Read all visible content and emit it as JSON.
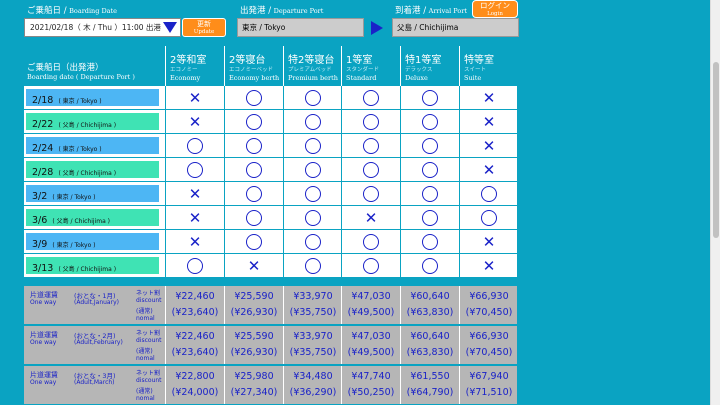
{
  "header": {
    "boarding_date_label_jp": "ご乗船日 /",
    "boarding_date_label_en": "Boarding Date",
    "boarding_date_value": "2021/02/18（ 木 / Thu ）11:00 出港",
    "update_label_jp": "更新",
    "update_label_en": "Update",
    "departure_label_jp": "出発港 /",
    "departure_label_en": "Departure Port",
    "departure_value": "東京 / Tokyo",
    "arrival_label_jp": "到着港 /",
    "arrival_label_en": "Arrival Port",
    "arrival_value": "父島 / Chichijima",
    "login_jp": "ログイン",
    "login_en": "Login"
  },
  "table": {
    "boarding_col_jp": "ご乗船日（出発港）",
    "boarding_col_en": "Boarding date ( Departure Port )",
    "classes": [
      {
        "jp": "2等和室",
        "sub": "エコノミー",
        "en": "Economy"
      },
      {
        "jp": "2等寝台",
        "sub": "エコノミーベッド",
        "en": "Economy berth"
      },
      {
        "jp": "特2等寝台",
        "sub": "プレミアムベッド",
        "en": "Premium berth"
      },
      {
        "jp": "1等室",
        "sub": "スタンダード",
        "en": "Standard"
      },
      {
        "jp": "特1等室",
        "sub": "デラックス",
        "en": "Deluxe"
      },
      {
        "jp": "特等室",
        "sub": "スイート",
        "en": "Suite"
      }
    ],
    "rows": [
      {
        "date": "2/18",
        "port": "( 東京 / Tokyo )",
        "color": "#4db6f4",
        "marks": [
          "x",
          "o",
          "o",
          "o",
          "o",
          "x"
        ]
      },
      {
        "date": "2/22",
        "port": "( 父島 / Chichijima )",
        "color": "#3fe3b4",
        "marks": [
          "x",
          "o",
          "o",
          "o",
          "o",
          "x"
        ]
      },
      {
        "date": "2/24",
        "port": "( 東京 / Tokyo )",
        "color": "#4db6f4",
        "marks": [
          "o",
          "o",
          "o",
          "o",
          "o",
          "x"
        ]
      },
      {
        "date": "2/28",
        "port": "( 父島 / Chichijima )",
        "color": "#3fe3b4",
        "marks": [
          "o",
          "o",
          "o",
          "o",
          "o",
          "x"
        ]
      },
      {
        "date": "3/2",
        "port": "( 東京 / Tokyo )",
        "color": "#4db6f4",
        "marks": [
          "x",
          "o",
          "o",
          "o",
          "o",
          "o"
        ]
      },
      {
        "date": "3/6",
        "port": "( 父島 / Chichijima )",
        "color": "#3fe3b4",
        "marks": [
          "x",
          "o",
          "o",
          "x",
          "o",
          "o"
        ]
      },
      {
        "date": "3/9",
        "port": "( 東京 / Tokyo )",
        "color": "#4db6f4",
        "marks": [
          "x",
          "o",
          "o",
          "o",
          "o",
          "x"
        ]
      },
      {
        "date": "3/13",
        "port": "( 父島 / Chichijima )",
        "color": "#3fe3b4",
        "marks": [
          "o",
          "x",
          "o",
          "o",
          "o",
          "x"
        ]
      }
    ],
    "fares": [
      {
        "oneway_jp": "片道運賃",
        "oneway_en": "One way",
        "pax_jp": "(おとな・1月)",
        "pax_en": "(Adult,January)",
        "discount_label": "ネット割 discount",
        "normal_label": "(通常) nomal",
        "discount": [
          "¥22,460",
          "¥25,590",
          "¥33,970",
          "¥47,030",
          "¥60,640",
          "¥66,930"
        ],
        "normal": [
          "(¥23,640)",
          "(¥26,930)",
          "(¥35,750)",
          "(¥49,500)",
          "(¥63,830)",
          "(¥70,450)"
        ]
      },
      {
        "oneway_jp": "片道運賃",
        "oneway_en": "One way",
        "pax_jp": "(おとな・2月)",
        "pax_en": "(Adult,February)",
        "discount_label": "ネット割 discount",
        "normal_label": "(通常) nomal",
        "discount": [
          "¥22,460",
          "¥25,590",
          "¥33,970",
          "¥47,030",
          "¥60,640",
          "¥66,930"
        ],
        "normal": [
          "(¥23,640)",
          "(¥26,930)",
          "(¥35,750)",
          "(¥49,500)",
          "(¥63,830)",
          "(¥70,450)"
        ]
      },
      {
        "oneway_jp": "片道運賃",
        "oneway_en": "One way",
        "pax_jp": "(おとな・3月)",
        "pax_en": "(Adult,March)",
        "discount_label": "ネット割 discount",
        "normal_label": "(通常) nomal",
        "discount": [
          "¥22,800",
          "¥25,980",
          "¥34,480",
          "¥47,740",
          "¥61,550",
          "¥67,940"
        ],
        "normal": [
          "(¥24,000)",
          "(¥27,340)",
          "(¥36,290)",
          "(¥50,250)",
          "(¥64,790)",
          "(¥71,510)"
        ]
      }
    ]
  },
  "colors": {
    "background": "#0aa3c2",
    "accent_blue": "#1a22c8",
    "button_orange": "#ff8d1a",
    "fare_bg": "#b6b6b6"
  }
}
